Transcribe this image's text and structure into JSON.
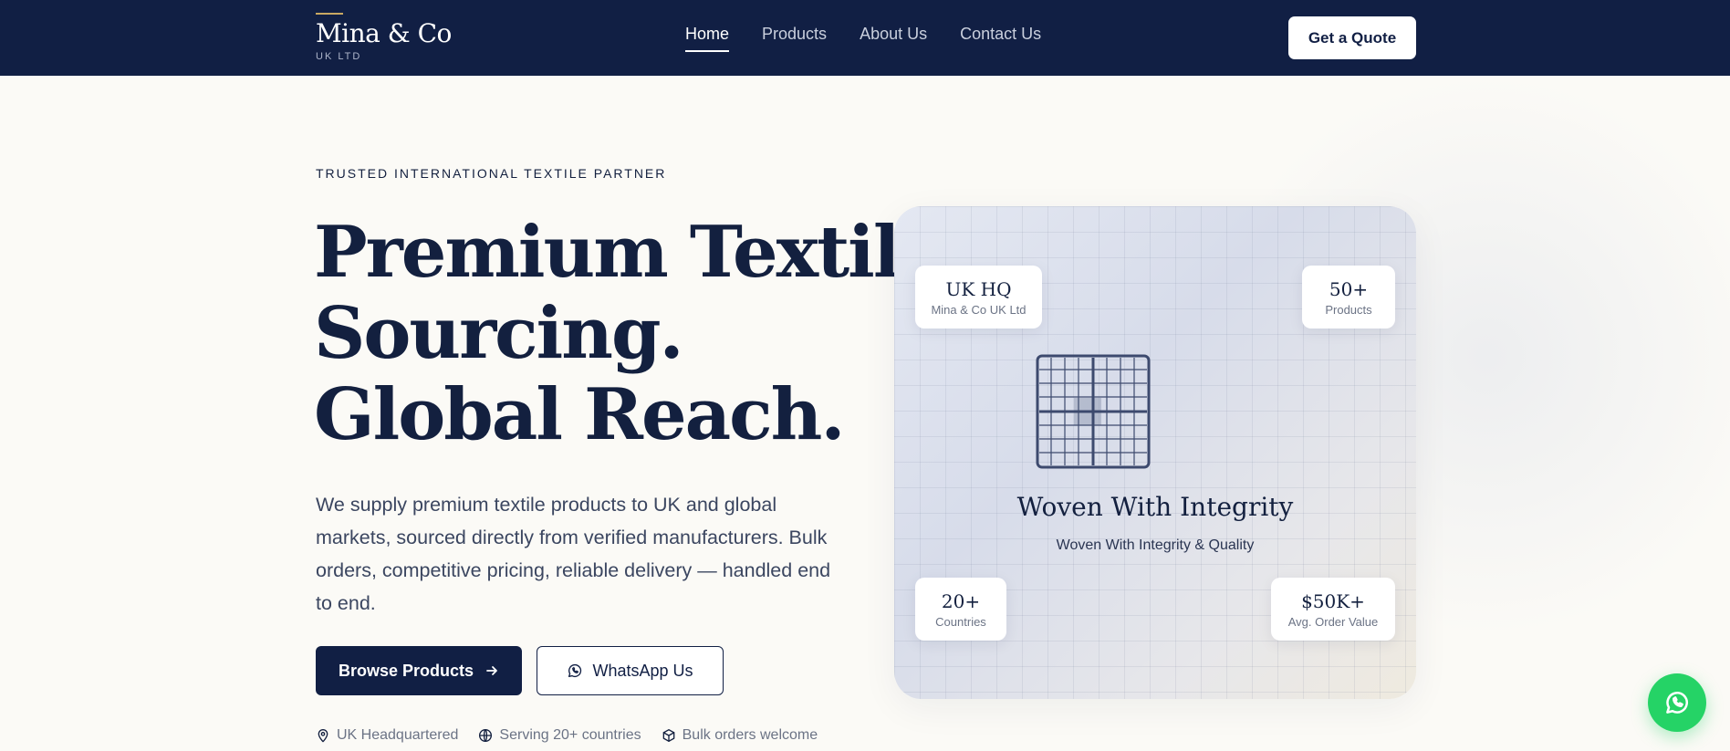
{
  "header": {
    "brand_name": "Mina & Co",
    "brand_sub": "UK LTD",
    "nav": [
      {
        "label": "Home",
        "active": true
      },
      {
        "label": "Products",
        "active": false
      },
      {
        "label": "About Us",
        "active": false
      },
      {
        "label": "Contact Us",
        "active": false
      }
    ],
    "cta_label": "Get a Quote"
  },
  "hero": {
    "eyebrow": "TRUSTED INTERNATIONAL TEXTILE PARTNER",
    "headline_lines": [
      "Premium Textile",
      "Sourcing.",
      "Global Reach."
    ],
    "lead": "We supply premium textile products to UK and global markets, sourced directly from verified manufacturers. Bulk orders, competitive pricing, reliable delivery — handled end to end.",
    "primary_button": "Browse Products",
    "secondary_button": "WhatsApp Us",
    "features": [
      {
        "icon": "map-pin-icon",
        "label": "UK Headquartered"
      },
      {
        "icon": "globe-icon",
        "label": "Serving 20+ countries"
      },
      {
        "icon": "box-icon",
        "label": "Bulk orders welcome"
      }
    ]
  },
  "visual": {
    "title": "Woven With Integrity",
    "subtitle": "Woven With Integrity & Quality",
    "stats": [
      {
        "value": "UK HQ",
        "label": "Mina & Co UK Ltd"
      },
      {
        "value": "50+",
        "label": "Products"
      },
      {
        "value": "20+",
        "label": "Countries"
      },
      {
        "value": "$50K+",
        "label": "Avg. Order Value"
      }
    ]
  },
  "colors": {
    "navy": "#111f44",
    "background": "#fbfaf6",
    "accent_gold": "#c9a862",
    "whatsapp_green": "#25d366"
  },
  "floating_button_icon": "whatsapp-icon"
}
